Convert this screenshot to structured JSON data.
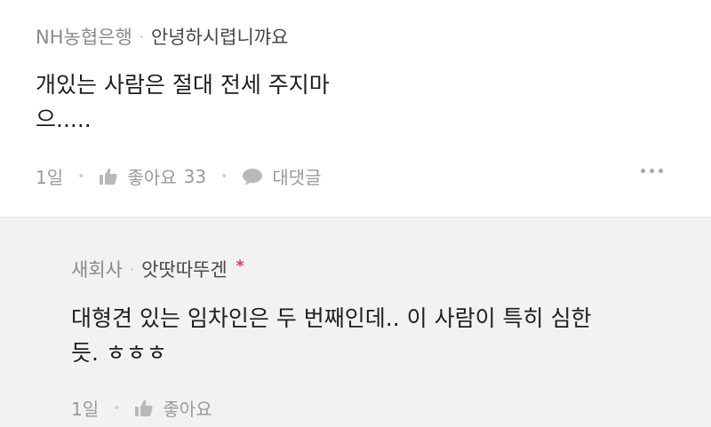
{
  "comment": {
    "company": "NH농협은행",
    "separator": "·",
    "nickname": "안녕하시렵니꺄요",
    "text_line1": "개있는 사람은 절대 전세 주지마",
    "text_line2": "으.....",
    "time": "1일",
    "like_label": "좋아요",
    "like_count": "33",
    "reply_label": "대댓글",
    "icons": {
      "like": "thumbs-up-icon",
      "reply": "speech-bubble-icon",
      "more": "more-dots-icon"
    }
  },
  "reply": {
    "company": "새회사",
    "separator": "·",
    "nickname": "앗땃따뚜겐",
    "author_mark": "*",
    "text_line1": "대형견 있는 임차인은 두 번째인데.. 이 사람이 특히 심한",
    "text_line2": "듯. ㅎㅎㅎ",
    "time": "1일",
    "like_label": "좋아요",
    "icons": {
      "like": "thumbs-up-icon"
    }
  },
  "colors": {
    "author_mark": "#e0383e",
    "reply_background": "#f2f2f4"
  }
}
